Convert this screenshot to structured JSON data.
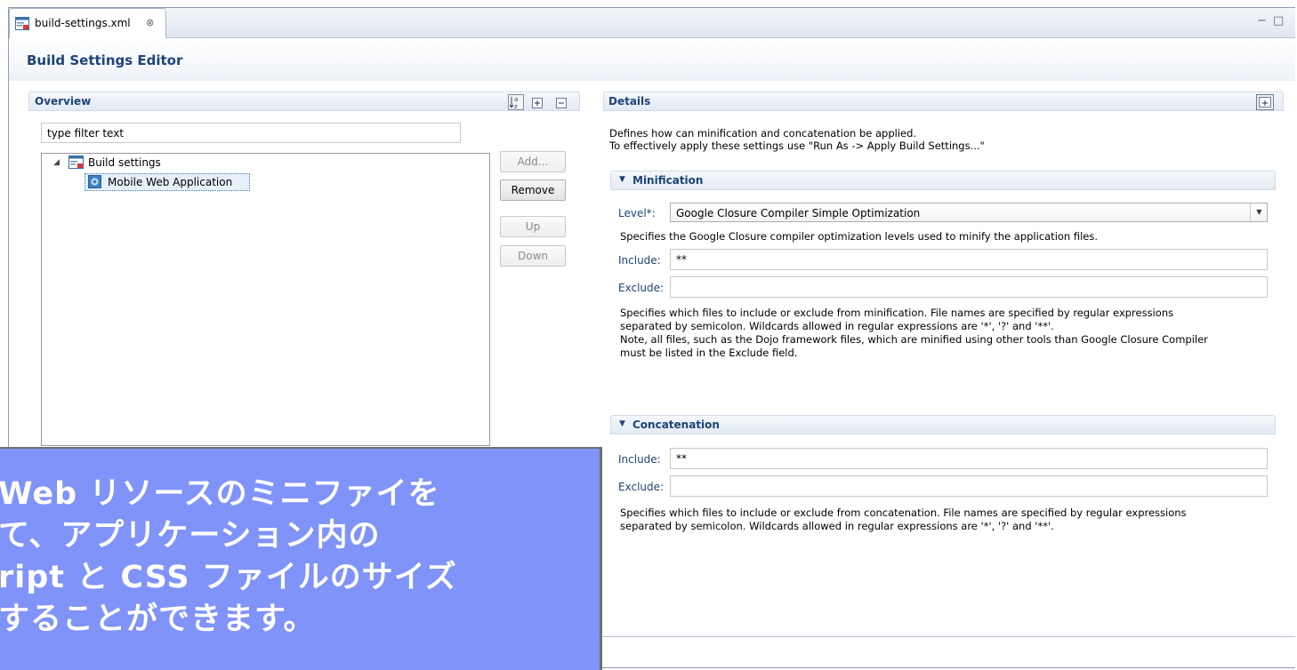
{
  "tab": {
    "label": "build-settings.xml",
    "close_glyph": "⊗"
  },
  "window_controls": {
    "minimize": "−",
    "maximize": "□"
  },
  "editor": {
    "title": "Build Settings Editor"
  },
  "overview": {
    "title": "Overview",
    "filter_placeholder": "type filter text",
    "tree": [
      {
        "label": "Build settings",
        "expanded": true,
        "icon": "build-settings-icon"
      },
      {
        "label": "Mobile Web Application",
        "selected": true,
        "icon": "mobile-web-app-icon"
      }
    ],
    "buttons": {
      "add": "Add...",
      "remove": "Remove",
      "up": "Up",
      "down": "Down"
    }
  },
  "details": {
    "title": "Details",
    "intro_line1": "Defines how can minification and concatenation be applied.",
    "intro_line2": "To effectively apply these settings use \"Run As -> Apply Build Settings...\"",
    "minification": {
      "title": "Minification",
      "level_label": "Level*:",
      "level_value": "Google Closure Compiler Simple Optimization",
      "level_desc": "Specifies the Google Closure compiler optimization levels used to minify the application files.",
      "include_label": "Include:",
      "include_value": "**",
      "exclude_label": "Exclude:",
      "exclude_value": "",
      "desc_line1": "Specifies which files to include or exclude from minification. File names are specified by regular expressions",
      "desc_line2": "separated by semicolon. Wildcards allowed in regular expressions are '*', '?' and '**'.",
      "desc_line3": "Note, all files, such as the Dojo framework files, which are minified using other tools than Google Closure Compiler",
      "desc_line4": "must be listed in the Exclude field."
    },
    "concatenation": {
      "title": "Concatenation",
      "include_label": "Include:",
      "include_value": "**",
      "exclude_label": "Exclude:",
      "exclude_value": "",
      "desc_line1": "Specifies which files to include or exclude from concatenation. File names are specified by regular expressions",
      "desc_line2": "separated by semicolon. Wildcards allowed in regular expressions are '*', '?' and '**'."
    }
  },
  "overlay": {
    "line1": "Web リソースのミニファイを",
    "line2": "て、アプリケーション内の",
    "line3": "ript と CSS ファイルのサイズ",
    "line4": "することができます。"
  },
  "colors": {
    "accent": "#1d4477",
    "overlay": "#8093f8"
  }
}
